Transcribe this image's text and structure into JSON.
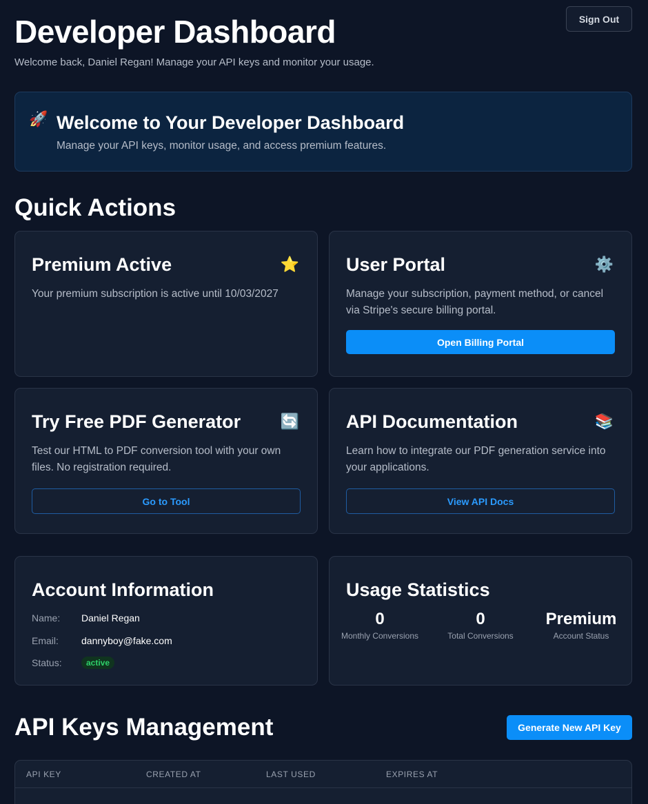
{
  "header": {
    "title": "Developer Dashboard",
    "subtitle": "Welcome back, Daniel Regan! Manage your API keys and monitor your usage.",
    "signout_label": "Sign Out"
  },
  "welcome": {
    "icon": "rocket-icon",
    "title": "Welcome to Your Developer Dashboard",
    "text": "Manage your API keys, monitor usage, and access premium features."
  },
  "quick_actions": {
    "title": "Quick Actions",
    "premium": {
      "title": "Premium Active",
      "icon": "star-icon",
      "text": "Your premium subscription is active until 10/03/2027"
    },
    "portal": {
      "title": "User Portal",
      "icon": "gear-icon",
      "text": "Manage your subscription, payment method, or cancel via Stripe's secure billing portal.",
      "button": "Open Billing Portal"
    },
    "pdf": {
      "title": "Try Free PDF Generator",
      "icon": "refresh-icon",
      "text": "Test our HTML to PDF conversion tool with your own files. No registration required.",
      "button": "Go to Tool"
    },
    "docs": {
      "title": "API Documentation",
      "icon": "books-icon",
      "text": "Learn how to integrate our PDF generation service into your applications.",
      "button": "View API Docs"
    }
  },
  "account": {
    "title": "Account Information",
    "name_label": "Name:",
    "name": "Daniel Regan",
    "email_label": "Email:",
    "email": "dannyboy@fake.com",
    "status_label": "Status:",
    "status": "active"
  },
  "usage": {
    "title": "Usage Statistics",
    "stats": [
      {
        "value": "0",
        "label": "Monthly Conversions"
      },
      {
        "value": "0",
        "label": "Total Conversions"
      },
      {
        "value": "Premium",
        "label": "Account Status"
      }
    ]
  },
  "api_keys": {
    "title": "API Keys Management",
    "generate_button": "Generate New API Key",
    "columns": [
      "API KEY",
      "CREATED AT",
      "LAST USED",
      "EXPIRES AT"
    ]
  },
  "colors": {
    "background": "#0d1526",
    "card": "#151f31",
    "accent": "#0b8ef8",
    "success": "#2ed06a"
  }
}
